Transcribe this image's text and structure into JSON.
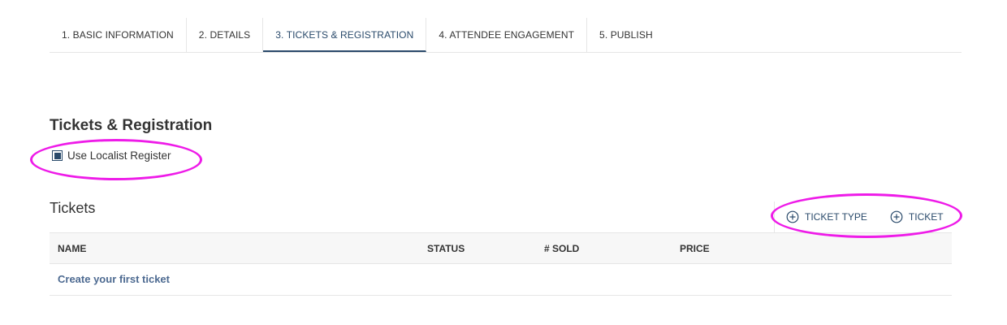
{
  "tabs": [
    {
      "label": "1. BASIC INFORMATION"
    },
    {
      "label": "2. DETAILS"
    },
    {
      "label": "3. TICKETS & REGISTRATION"
    },
    {
      "label": "4. ATTENDEE ENGAGEMENT"
    },
    {
      "label": "5. PUBLISH"
    }
  ],
  "active_tab": "3. TICKETS & REGISTRATION",
  "section": {
    "title": "Tickets & Registration",
    "checkbox_label": "Use Localist Register",
    "checkbox_checked": true
  },
  "tickets": {
    "title": "Tickets",
    "actions": {
      "ticket_type_label": "TICKET TYPE",
      "ticket_label": "TICKET",
      "icon": "plus-circle-icon"
    },
    "columns": [
      "NAME",
      "STATUS",
      "# SOLD",
      "PRICE"
    ],
    "empty_link": "Create your first ticket"
  },
  "colors": {
    "accent": "#2a4a6b",
    "link": "#4d6a91",
    "annotation": "#ee1be8",
    "header_bg": "#f7f7f7",
    "border": "#e6e6e6"
  }
}
